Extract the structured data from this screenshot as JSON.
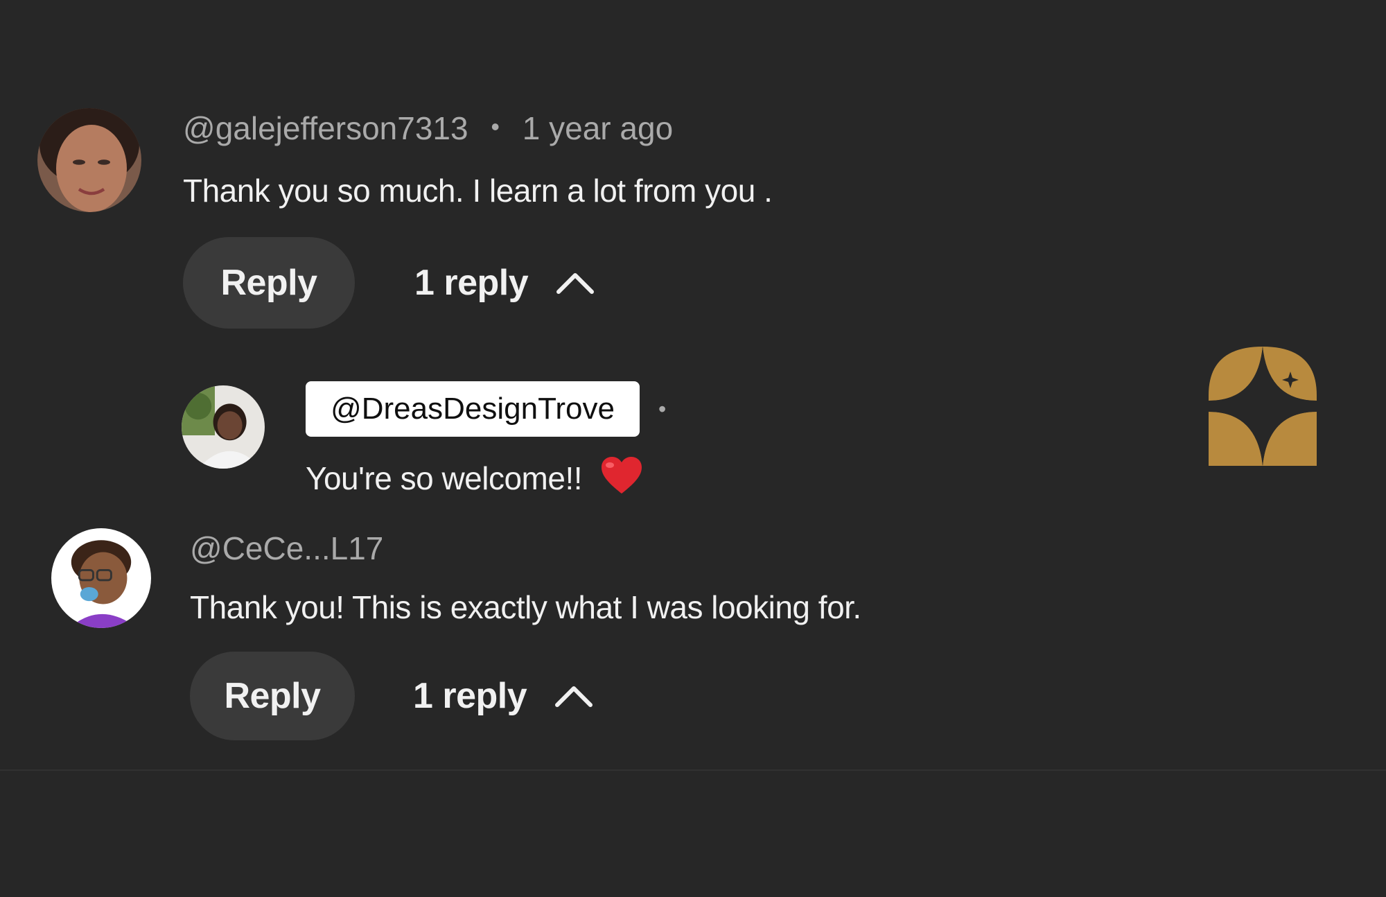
{
  "comments": [
    {
      "author": "@galejefferson7313",
      "separator": "•",
      "time": "1 year ago",
      "text": "Thank you so much. I learn a lot from you .",
      "reply_label": "Reply",
      "replies_label": "1 reply",
      "reply": {
        "author": "@DreasDesignTrove",
        "separator": "•",
        "text": "You're so welcome!!",
        "emoji": "❤️"
      }
    },
    {
      "author": "@CeCe...L17",
      "text": "Thank you! This is exactly what I was looking for.",
      "reply_label": "Reply",
      "replies_label": "1 reply"
    }
  ],
  "icons": {
    "expanded": "chevron-up-icon",
    "badge": "sparkle-badge-icon"
  },
  "colors": {
    "background": "#272727",
    "button": "#3a3a3a",
    "muted_text": "#aaaaaa",
    "badge_gold": "#b88a3e"
  }
}
